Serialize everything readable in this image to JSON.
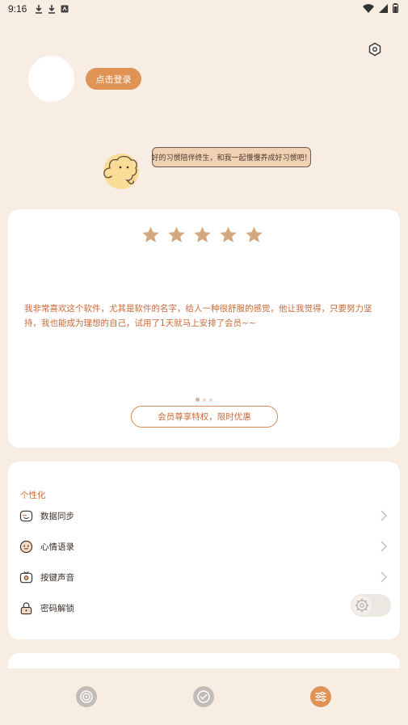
{
  "status_bar": {
    "time": "9:16"
  },
  "profile": {
    "login_label": "点击登录"
  },
  "mascot": {
    "speech": "好的习惯陪伴终生，和我一起慢慢养成好习惯吧！"
  },
  "review": {
    "rating": 5,
    "max_rating": 5,
    "text": "我非常喜欢这个软件，尤其是软件的名字，给人一种很舒服的感觉，他让我觉得，只要努力坚持，我也能成为理想的自己，试用了1天就马上安排了会员~~",
    "page_index": 1,
    "page_count": 3,
    "member_button": "会员尊享特权，限时优惠"
  },
  "settings": {
    "section_title": "个性化",
    "items": [
      {
        "label": "数据同步",
        "icon": "sync-icon"
      },
      {
        "label": "心情语录",
        "icon": "mood-icon"
      },
      {
        "label": "按键声音",
        "icon": "sound-icon"
      },
      {
        "label": "密码解锁",
        "icon": "lock-icon"
      }
    ],
    "password_unlock_enabled": false
  },
  "bottom_nav": {
    "items": [
      {
        "icon": "target-icon",
        "active": false
      },
      {
        "icon": "check-circle-icon",
        "active": false
      },
      {
        "icon": "sliders-icon",
        "active": true
      }
    ]
  },
  "colors": {
    "background": "#f8ede2",
    "accent": "#df9354",
    "accent_text": "#c96a3a",
    "star": "#d6a67e"
  }
}
